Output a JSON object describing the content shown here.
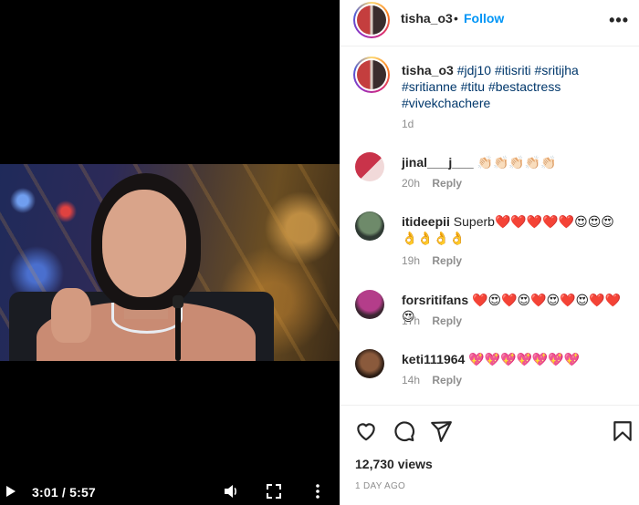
{
  "video": {
    "time_display": "3:01 / 5:57",
    "icons": [
      "play-icon",
      "volume-icon",
      "fullscreen-icon",
      "more-vertical-icon"
    ]
  },
  "header": {
    "username": "tisha_o3",
    "separator": "•",
    "follow_label": "Follow",
    "more_label": "•••"
  },
  "caption": {
    "username": "tisha_o3",
    "hashtags": [
      "#jdj10",
      "#itisriti",
      "#sritijha",
      "#sritianne",
      "#titu",
      "#bestactress",
      "#vivekchachere"
    ],
    "time": "1d"
  },
  "comments": [
    {
      "username": "jinal___j___",
      "text": "👏🏻👏🏻👏🏻👏🏻👏🏻",
      "time": "20h",
      "reply_label": "Reply",
      "avatar_colors": [
        "#c9334a",
        "#f1d9d9"
      ]
    },
    {
      "username": "itideepii",
      "text": "Superb❤️❤️❤️❤️❤️😍😍😍👌👌👌👌",
      "time": "19h",
      "reply_label": "Reply",
      "avatar_colors": [
        "#6e8a6a",
        "#2f3a33"
      ]
    },
    {
      "username": "forsritifans",
      "text": "❤️😍❤️😍❤️😍❤️😍❤️❤️😍",
      "time": "17h",
      "reply_label": "Reply",
      "avatar_colors": [
        "#b43d8a",
        "#3a2530"
      ]
    },
    {
      "username": "keti111964",
      "text": "💖💖💖💖💖💖💖",
      "time": "14h",
      "reply_label": "Reply",
      "avatar_colors": [
        "#8a5a3c",
        "#2b1c14"
      ]
    }
  ],
  "actions": {
    "icons": [
      "heart-icon",
      "comment-icon",
      "share-icon",
      "save-icon"
    ],
    "views": "12,730 views",
    "posted": "1 DAY AGO"
  }
}
